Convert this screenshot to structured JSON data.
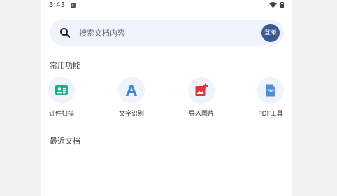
{
  "status_bar": {
    "time": "3:43"
  },
  "search": {
    "placeholder": "搜索文档内容",
    "login_label": "登录"
  },
  "sections": {
    "common_title": "常用功能",
    "recent_title": "最近文档"
  },
  "functions": [
    {
      "label": "证件扫描",
      "icon": "id-card-icon",
      "color": "#1fae8a"
    },
    {
      "label": "文字识别",
      "icon": "text-recognition-icon",
      "color": "#3a86d8"
    },
    {
      "label": "导入图片",
      "icon": "import-image-icon",
      "color": "#e0323a"
    },
    {
      "label": "PDF工具",
      "icon": "pdf-tool-icon",
      "color": "#4a90d9"
    }
  ],
  "colors": {
    "accent": "#3b5a92",
    "search_bg": "#eef3fc"
  }
}
